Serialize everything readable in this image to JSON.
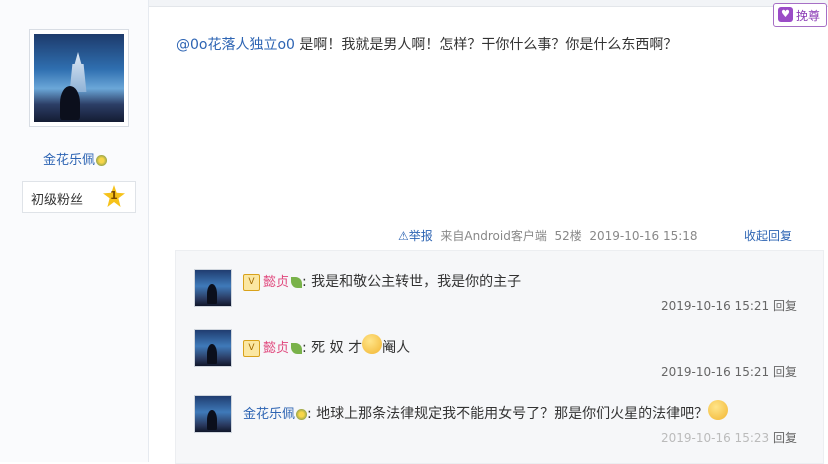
{
  "corner_button": {
    "label": "挽尊"
  },
  "poster": {
    "username": "金花乐佩",
    "level_label": "初级粉丝",
    "level_number": "1"
  },
  "post": {
    "mention": "@0o花落人独立o0",
    "text": " 是啊！我就是男人啊！怎样？干你什么事？你是什么东西啊？"
  },
  "meta": {
    "report_label": "举报",
    "source": "来自Android客户端",
    "floor": "52楼",
    "time": "2019-10-16 15:18",
    "collapse_label": "收起回复"
  },
  "replies": [
    {
      "vip": "V",
      "name": "懿贞",
      "text": ": 我是和敬公主转世，我是你的主子",
      "time": "2019-10-16 15:21",
      "reply_label": "回复"
    },
    {
      "vip": "V",
      "name": "懿贞",
      "text_before": ": 死 奴 才",
      "text_after": "阉人",
      "time": "2019-10-16 15:21",
      "reply_label": "回复"
    },
    {
      "name": "金花乐佩",
      "text": ": 地球上那条法律规定我不能用女号了？那是你们火星的法律吧？",
      "time": "2019-10-16 15:23",
      "reply_label": "回复"
    }
  ]
}
